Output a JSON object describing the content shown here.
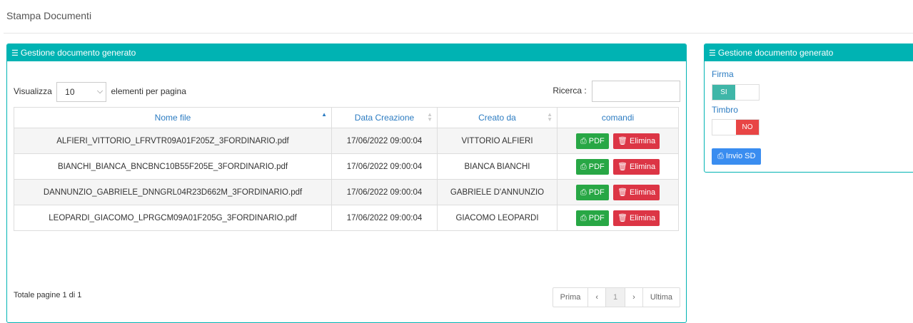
{
  "page": {
    "title": "Stampa Documenti"
  },
  "panel_main": {
    "title": "Gestione documento generato",
    "length_prefix": "Visualizza",
    "length_value": "10",
    "length_suffix": "elementi per pagina",
    "search_label": "Ricerca :",
    "columns": [
      "Nome file",
      "Data Creazione",
      "Creato da",
      "comandi"
    ],
    "rows": [
      {
        "file": "ALFIERI_VITTORIO_LFRVTR09A01F205Z_3FORDINARIO.pdf",
        "date": "17/06/2022 09:00:04",
        "author": "VITTORIO ALFIERI"
      },
      {
        "file": "BIANCHI_BIANCA_BNCBNC10B55F205E_3FORDINARIO.pdf",
        "date": "17/06/2022 09:00:04",
        "author": "BIANCA BIANCHI"
      },
      {
        "file": "DANNUNZIO_GABRIELE_DNNGRL04R23D662M_3FORDINARIO.pdf",
        "date": "17/06/2022 09:00:04",
        "author": "GABRIELE D'ANNUNZIO"
      },
      {
        "file": "LEOPARDI_GIACOMO_LPRGCM09A01F205G_3FORDINARIO.pdf",
        "date": "17/06/2022 09:00:04",
        "author": "GIACOMO LEOPARDI"
      }
    ],
    "pdf_label": "PDF",
    "delete_label": "Elimina",
    "footer": "Totale pagine 1 di 1",
    "pager": {
      "first": "Prima",
      "prev": "‹",
      "current": "1",
      "next": "›",
      "last": "Ultima"
    }
  },
  "panel_side": {
    "title": "Gestione documento generato",
    "firma_label": "Firma",
    "firma_value": "SI",
    "timbro_label": "Timbro",
    "timbro_value": "NO",
    "send_label": "Invio SD"
  },
  "colors": {
    "accent": "#00b3b3",
    "link": "#2c7cc2",
    "pdf": "#28a745",
    "delete": "#dc3545",
    "send": "#3a8df0"
  },
  "icons": {
    "panel": "list-icon",
    "pdf": "printer-icon",
    "delete": "trash-icon",
    "send": "printer-icon"
  }
}
